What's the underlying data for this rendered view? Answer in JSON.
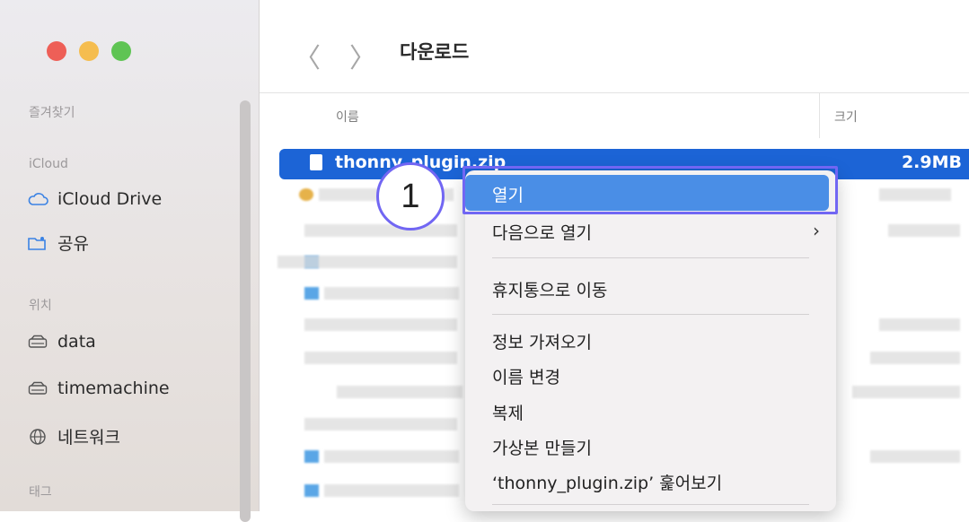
{
  "sidebar": {
    "sections": {
      "favorites": "즐겨찾기",
      "icloud": "iCloud",
      "locations": "위치",
      "tags": "태그"
    },
    "items": {
      "icloud_drive": "iCloud Drive",
      "shared": "공유",
      "data": "data",
      "timemachine": "timemachine",
      "network": "네트워크"
    }
  },
  "toolbar": {
    "back": "〈",
    "forward": "〉",
    "title": "다운로드"
  },
  "columns": {
    "name": "이름",
    "size": "크기"
  },
  "selected_file": {
    "name": "thonny_plugin.zip",
    "size": "2.9MB"
  },
  "context_menu": {
    "open": "열기",
    "open_with": "다음으로 열기",
    "move_to_trash": "휴지통으로 이동",
    "get_info": "정보 가져오기",
    "rename": "이름 변경",
    "duplicate": "복제",
    "make_alias": "가상본 만들기",
    "quick_look": "‘thonny_plugin.zip’ 훑어보기"
  },
  "annotation": {
    "step": "1"
  },
  "colors": {
    "selection": "#1c64d6",
    "menu_highlight": "#4a8ee6",
    "annotation": "#7166f3"
  }
}
